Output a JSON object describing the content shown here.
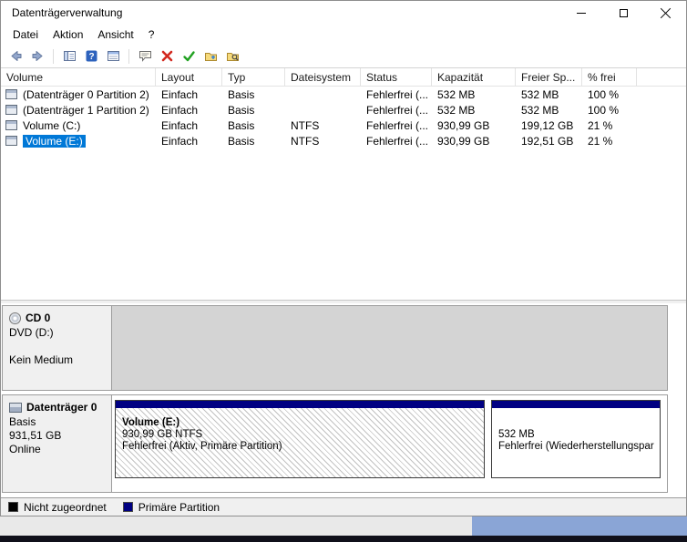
{
  "colors": {
    "selection": "#0078d7",
    "primary_partition": "#000082",
    "unallocated": "#000000"
  },
  "window": {
    "title": "Datenträgerverwaltung"
  },
  "menu": {
    "items": [
      "Datei",
      "Aktion",
      "Ansicht",
      "?"
    ]
  },
  "table": {
    "columns": [
      "Volume",
      "Layout",
      "Typ",
      "Dateisystem",
      "Status",
      "Kapazität",
      "Freier Sp...",
      "% frei"
    ],
    "rows": [
      [
        "(Datenträger 0 Partition 2)",
        "Einfach",
        "Basis",
        "",
        "Fehlerfrei (...",
        "532 MB",
        "532 MB",
        "100 %"
      ],
      [
        "(Datenträger 1 Partition 2)",
        "Einfach",
        "Basis",
        "",
        "Fehlerfrei (...",
        "532 MB",
        "532 MB",
        "100 %"
      ],
      [
        "Volume (C:)",
        "Einfach",
        "Basis",
        "NTFS",
        "Fehlerfrei (...",
        "930,99 GB",
        "199,12 GB",
        "21 %"
      ],
      [
        "Volume (E:)",
        "Einfach",
        "Basis",
        "NTFS",
        "Fehlerfrei (...",
        "930,99 GB",
        "192,51 GB",
        "21 %"
      ]
    ],
    "selected_row_volume": "Volume (E:)"
  },
  "graphical": {
    "cd": {
      "title": "CD 0",
      "drive": "DVD (D:)",
      "media": "Kein Medium"
    },
    "disk": {
      "title": "Datenträger 0",
      "type": "Basis",
      "size": "931,51 GB",
      "status": "Online",
      "partitions": [
        {
          "label": "Volume (E:)",
          "size_fs": "930,99 GB NTFS",
          "status": "Fehlerfrei (Aktiv, Primäre Partition)"
        },
        {
          "label": "",
          "size_fs": "532 MB",
          "status": "Fehlerfrei (Wiederherstellungspar"
        }
      ]
    },
    "legend": [
      {
        "label": "Nicht zugeordnet",
        "color": "#000000"
      },
      {
        "label": "Primäre Partition",
        "color": "#000082"
      }
    ]
  }
}
